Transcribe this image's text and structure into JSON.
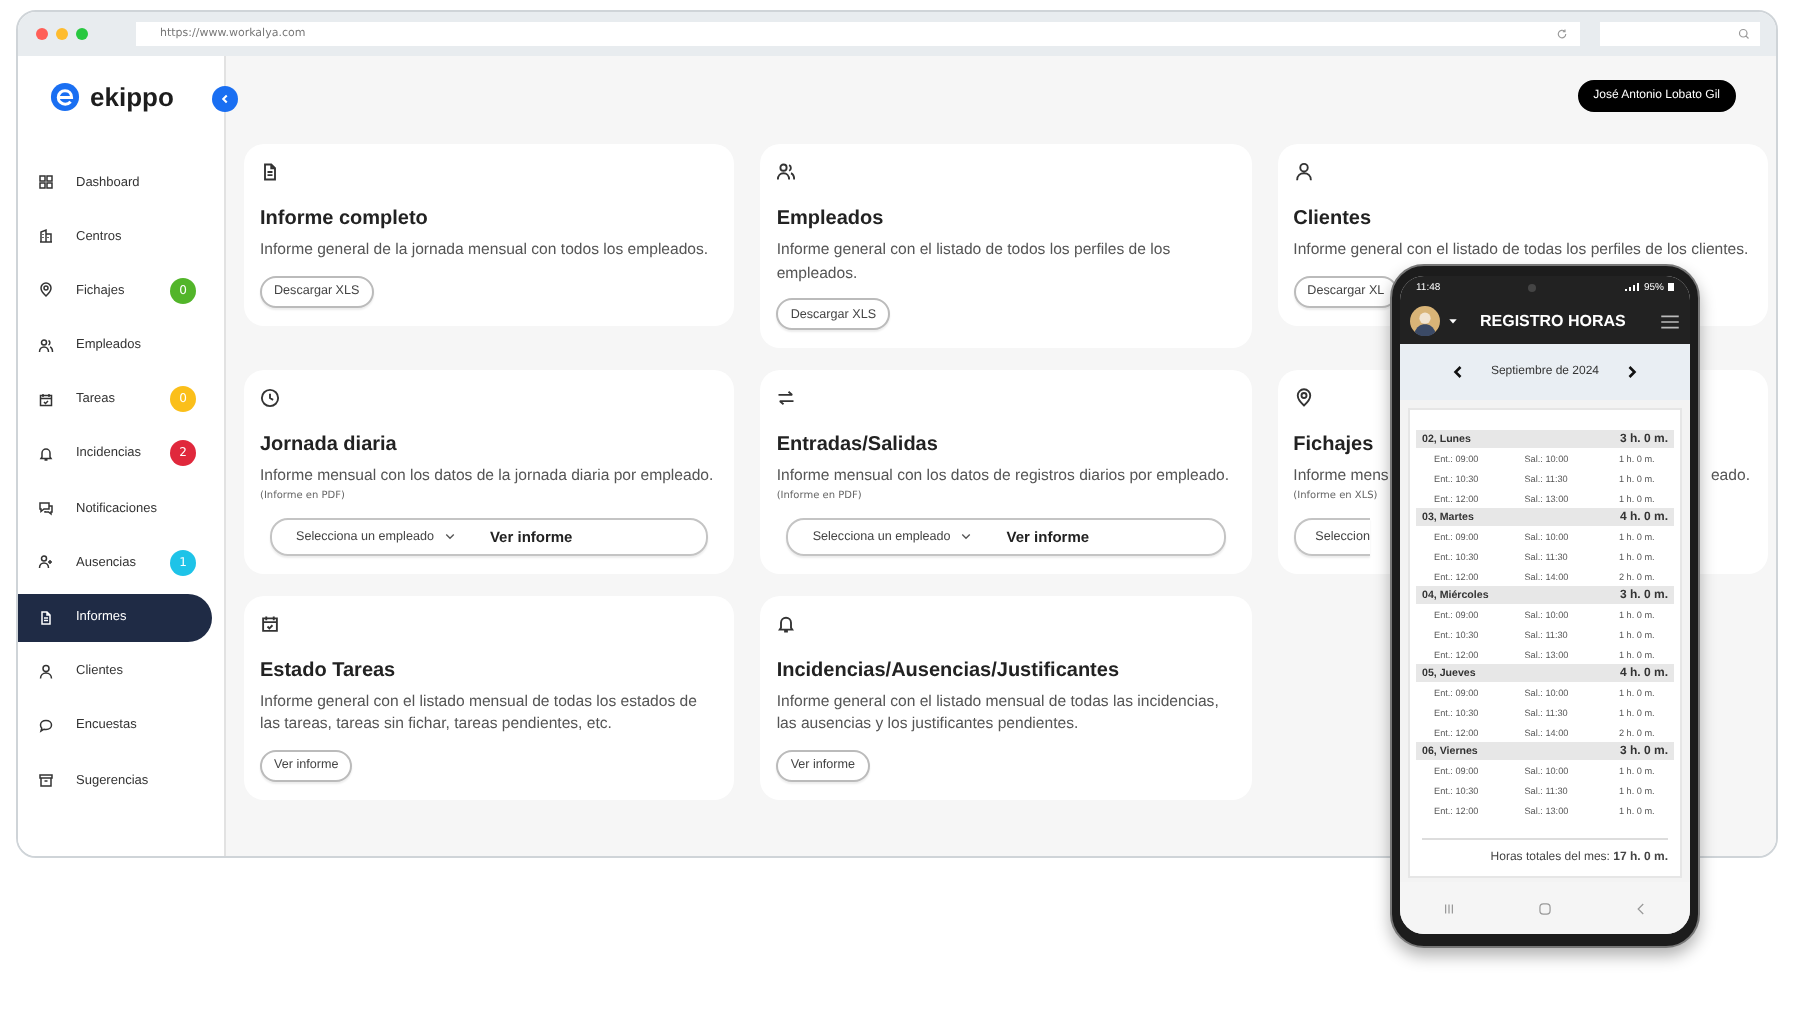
{
  "browser": {
    "url": "https://www.workalya.com"
  },
  "logo": {
    "text": "ekippo"
  },
  "sidebar": {
    "items": [
      {
        "label": "Dashboard",
        "selected": false
      },
      {
        "label": "Centros",
        "selected": false
      },
      {
        "label": "Fichajes",
        "selected": false,
        "badge": "0",
        "color": "#52b52a"
      },
      {
        "label": "Empleados",
        "selected": false
      },
      {
        "label": "Tareas",
        "selected": false,
        "badge": "0",
        "color": "#fbbf1a"
      },
      {
        "label": "Incidencias",
        "selected": false,
        "badge": "2",
        "color": "#e0283c"
      },
      {
        "label": "Notificaciones",
        "selected": false
      },
      {
        "label": "Ausencias",
        "selected": false,
        "badge": "1",
        "color": "#1ec3e8"
      },
      {
        "label": "Informes",
        "selected": true
      },
      {
        "label": "Clientes",
        "selected": false
      },
      {
        "label": "Encuestas",
        "selected": false
      },
      {
        "label": "Sugerencias",
        "selected": false
      }
    ]
  },
  "user": {
    "name": "José Antonio Lobato Gil"
  },
  "cards": [
    {
      "kind": "download",
      "title": "Informe completo",
      "description": "Informe general de la jornada mensual con todos los empleados.",
      "button": "Descargar XLS"
    },
    {
      "kind": "download",
      "title": "Empleados",
      "description": "Informe general con el listado de todos los perfiles de los empleados.",
      "button": "Descargar XLS"
    },
    {
      "kind": "download",
      "title": "Clientes",
      "description": "Informe general con el listado de todas los perfiles de los clientes.",
      "button": "Descargar XL"
    },
    {
      "kind": "select",
      "title": "Jornada diaria",
      "description": "Informe mensual con los datos de la jornada diaria por empleado.",
      "note": "(Informe en PDF)",
      "select": "Selecciona un empleado",
      "action": "Ver informe"
    },
    {
      "kind": "select",
      "title": "Entradas/Salidas",
      "description": "Informe mensual con los datos de registros diarios por empleado.",
      "note": "(Informe en PDF)",
      "select": "Selecciona un empleado",
      "action": "Ver informe"
    },
    {
      "kind": "select",
      "title": "Fichajes",
      "description_fragments": [
        "Informe mens",
        "eado."
      ],
      "note": "(Informe en XLS)",
      "select": "Seleccion"
    },
    {
      "kind": "view",
      "title": "Estado Tareas",
      "description": "Informe general con el listado mensual de todas los estados de las tareas, tareas sin fichar, tareas pendientes, etc.",
      "button": "Ver informe"
    },
    {
      "kind": "view",
      "title": "Incidencias/Ausencias/Justificantes",
      "description": "Informe general con el listado mensual de todas las incidencias, las ausencias y los justificantes pendientes.",
      "button": "Ver informe"
    }
  ],
  "phone": {
    "time": "11:48",
    "battery": "95%",
    "title": "REGISTRO HORAS",
    "month": "Septiembre de 2024",
    "days": [
      {
        "day": "02, Lunes",
        "total": "3 h. 0 m.",
        "entries": [
          [
            "Ent.: 09:00",
            "Sal.: 10:00",
            "1 h. 0 m."
          ],
          [
            "Ent.: 10:30",
            "Sal.: 11:30",
            "1 h. 0 m."
          ],
          [
            "Ent.: 12:00",
            "Sal.: 13:00",
            "1 h. 0 m."
          ]
        ]
      },
      {
        "day": "03, Martes",
        "total": "4 h. 0 m.",
        "entries": [
          [
            "Ent.: 09:00",
            "Sal.: 10:00",
            "1 h. 0 m."
          ],
          [
            "Ent.: 10:30",
            "Sal.: 11:30",
            "1 h. 0 m."
          ],
          [
            "Ent.: 12:00",
            "Sal.: 14:00",
            "2 h. 0 m."
          ]
        ]
      },
      {
        "day": "04, Miércoles",
        "total": "3 h. 0 m.",
        "entries": [
          [
            "Ent.: 09:00",
            "Sal.: 10:00",
            "1 h. 0 m."
          ],
          [
            "Ent.: 10:30",
            "Sal.: 11:30",
            "1 h. 0 m."
          ],
          [
            "Ent.: 12:00",
            "Sal.: 13:00",
            "1 h. 0 m."
          ]
        ]
      },
      {
        "day": "05, Jueves",
        "total": "4 h. 0 m.",
        "entries": [
          [
            "Ent.: 09:00",
            "Sal.: 10:00",
            "1 h. 0 m."
          ],
          [
            "Ent.: 10:30",
            "Sal.: 11:30",
            "1 h. 0 m."
          ],
          [
            "Ent.: 12:00",
            "Sal.: 14:00",
            "2 h. 0 m."
          ]
        ]
      },
      {
        "day": "06, Viernes",
        "total": "3 h. 0 m.",
        "entries": [
          [
            "Ent.: 09:00",
            "Sal.: 10:00",
            "1 h. 0 m."
          ],
          [
            "Ent.: 10:30",
            "Sal.: 11:30",
            "1 h. 0 m."
          ],
          [
            "Ent.: 12:00",
            "Sal.: 13:00",
            "1 h. 0 m."
          ]
        ]
      }
    ],
    "total": "Horas totales del mes: **17 h. 0 m.**"
  }
}
